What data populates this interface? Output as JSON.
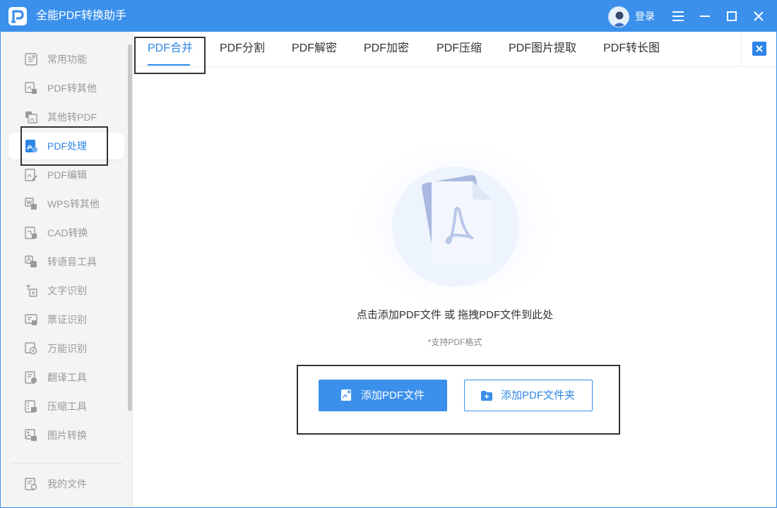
{
  "app": {
    "title": "全能PDF转换助手",
    "login_label": "登录"
  },
  "sidebar": {
    "items": [
      {
        "label": "常用功能",
        "icon": "common-features-icon"
      },
      {
        "label": "PDF转其他",
        "icon": "pdf-to-other-icon"
      },
      {
        "label": "其他转PDF",
        "icon": "other-to-pdf-icon"
      },
      {
        "label": "PDF处理",
        "icon": "pdf-process-icon",
        "active": true
      },
      {
        "label": "PDF编辑",
        "icon": "pdf-edit-icon"
      },
      {
        "label": "WPS转其他",
        "icon": "wps-convert-icon"
      },
      {
        "label": "CAD转换",
        "icon": "cad-convert-icon"
      },
      {
        "label": "转语音工具",
        "icon": "text-to-speech-icon"
      },
      {
        "label": "文字识别",
        "icon": "text-recognition-icon"
      },
      {
        "label": "票证识别",
        "icon": "ticket-recognition-icon"
      },
      {
        "label": "万能识别",
        "icon": "universal-recognition-icon"
      },
      {
        "label": "翻译工具",
        "icon": "translate-icon"
      },
      {
        "label": "压缩工具",
        "icon": "compress-icon"
      },
      {
        "label": "图片转换",
        "icon": "image-convert-icon"
      }
    ],
    "my_files": {
      "label": "我的文件",
      "icon": "my-files-icon"
    }
  },
  "tabs": [
    {
      "label": "PDF合并",
      "active": true
    },
    {
      "label": "PDF分割"
    },
    {
      "label": "PDF解密"
    },
    {
      "label": "PDF加密"
    },
    {
      "label": "PDF压缩"
    },
    {
      "label": "PDF图片提取"
    },
    {
      "label": "PDF转长图"
    }
  ],
  "main": {
    "hint": "点击添加PDF文件 或 拖拽PDF文件到此处",
    "subhint": "*支持PDF格式",
    "add_file_label": "添加PDF文件",
    "add_folder_label": "添加PDF文件夹"
  },
  "colors": {
    "accent": "#3b90ec",
    "active_text": "#2f86e6",
    "sidebar_bg": "#f3f4f6"
  }
}
